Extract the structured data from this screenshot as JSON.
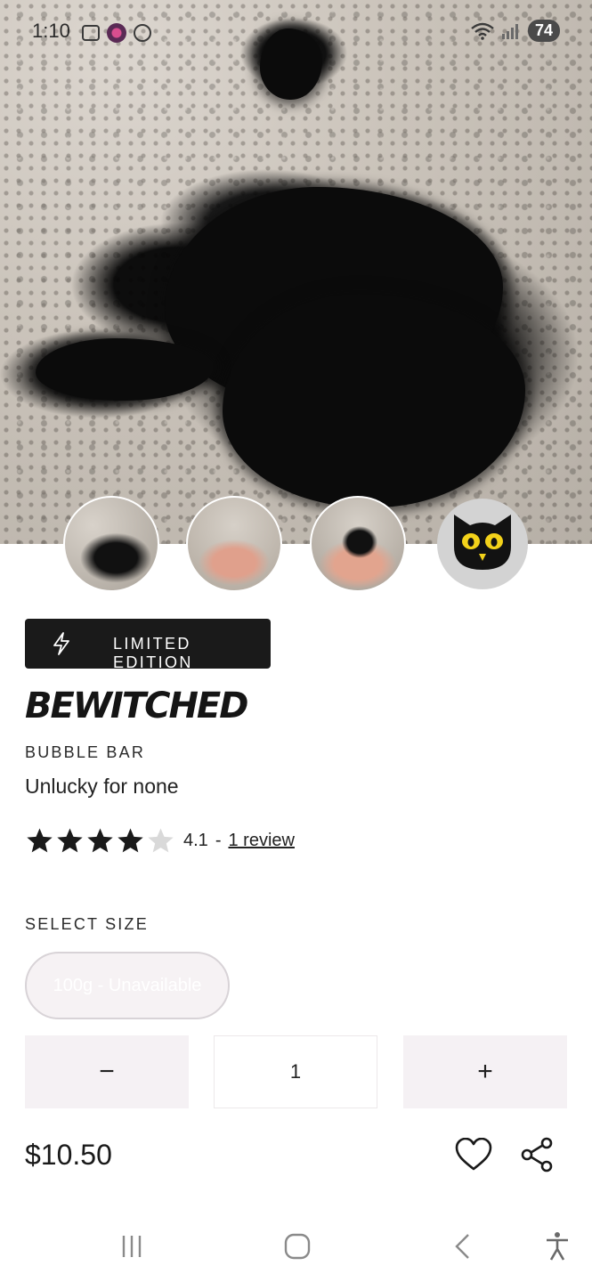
{
  "status_bar": {
    "time": "1:10",
    "battery": "74"
  },
  "hero": {
    "thumbnails": [
      {
        "name": "bath-water-thumbnail"
      },
      {
        "name": "hands-holding-bar-thumbnail"
      },
      {
        "name": "cat-bar-in-hands-thumbnail"
      },
      {
        "name": "cat-face-bar-thumbnail"
      }
    ]
  },
  "product": {
    "badge": "LIMITED EDITION",
    "name": "BEWITCHED",
    "category": "BUBBLE BAR",
    "tagline": "Unlucky for none",
    "rating": {
      "value": 4.1,
      "value_text": "4.1",
      "separator": "-",
      "stars_filled": 4,
      "stars_total": 5,
      "review_link": "1 review"
    },
    "price": "$10.50"
  },
  "size": {
    "label": "SELECT SIZE",
    "option": "100g - Unavailable"
  },
  "quantity": {
    "minus": "−",
    "value": "1",
    "plus": "+"
  },
  "colors": {
    "badge_bg": "#1a1a1a",
    "qty_btn_bg": "#f5f1f4",
    "star_filled": "#1a1a1a",
    "star_empty": "#d9d9d9"
  }
}
